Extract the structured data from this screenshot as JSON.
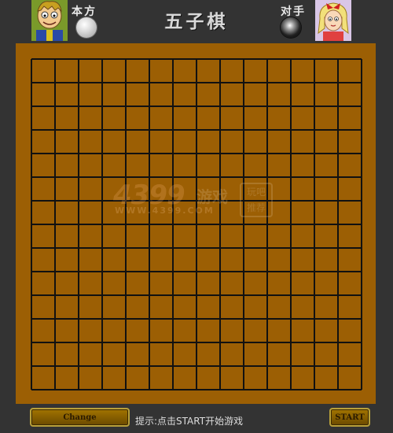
{
  "header": {
    "title": "五子棋",
    "self_label": "本方",
    "opponent_label": "对手",
    "self_stone": "white",
    "opponent_stone": "black"
  },
  "board": {
    "lines": 15,
    "background_color": "#9c5f04",
    "line_color": "#111111",
    "stones": []
  },
  "watermark": {
    "brand": "4399",
    "brand_cn": "游戏",
    "box_text": "玩吧 推荐",
    "url": "WWW.4399.COM"
  },
  "footer": {
    "change_label": "Change",
    "hint": "提示:点击START开始游戏",
    "start_label": "START"
  },
  "colors": {
    "page_background": "#333333",
    "button_fill": "#8a6000",
    "button_border": "#b8a03a"
  }
}
